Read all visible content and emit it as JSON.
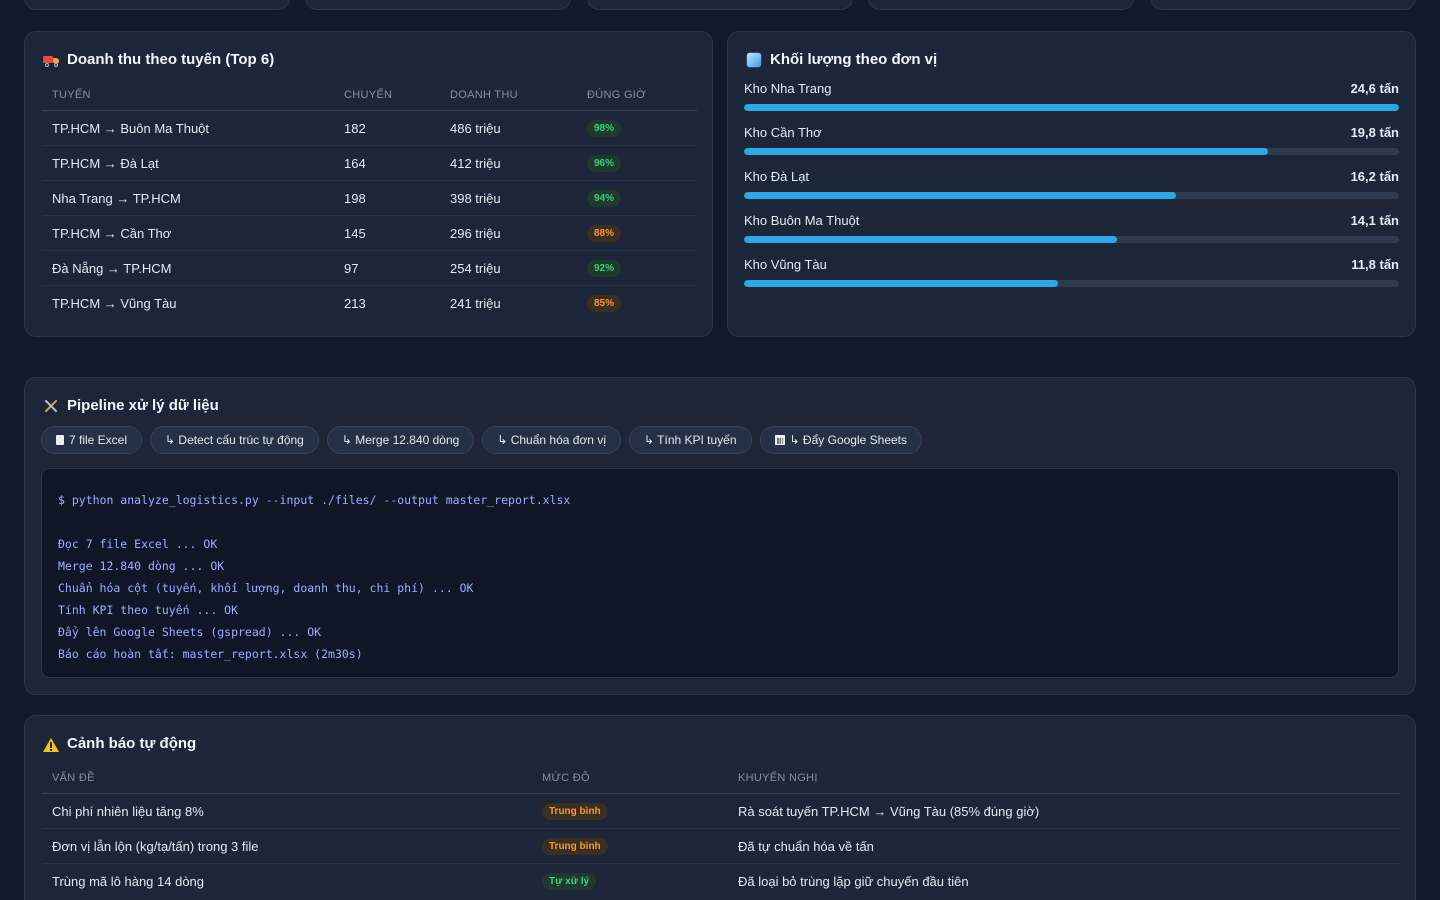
{
  "route_revenue": {
    "title": "Doanh thu theo tuyến (Top 6)",
    "columns": [
      "TUYẾN",
      "CHUYẾN",
      "DOANH THU",
      "ĐÚNG GIỜ"
    ],
    "rows": [
      {
        "route": "TP.HCM → Buôn Ma Thuột",
        "trips": "182",
        "revenue": "486 triệu",
        "ontime": "98%"
      },
      {
        "route": "TP.HCM → Đà Lạt",
        "trips": "164",
        "revenue": "412 triệu",
        "ontime": "96%"
      },
      {
        "route": "Nha Trang → TP.HCM",
        "trips": "198",
        "revenue": "398 triệu",
        "ontime": "94%"
      },
      {
        "route": "TP.HCM → Cần Thơ",
        "trips": "145",
        "revenue": "296 triệu",
        "ontime": "88%"
      },
      {
        "route": "Đà Nẵng → TP.HCM",
        "trips": "97",
        "revenue": "254 triệu",
        "ontime": "92%"
      },
      {
        "route": "TP.HCM → Vũng Tàu",
        "trips": "213",
        "revenue": "241 triệu",
        "ontime": "85%"
      }
    ]
  },
  "volume": {
    "title": "Khối lượng theo đơn vị",
    "items": [
      {
        "name": "Kho Nha Trang",
        "value": "24,6 tấn",
        "level": 1.0
      },
      {
        "name": "Kho Cần Thơ",
        "value": "19,8 tấn",
        "level": 0.8
      },
      {
        "name": "Kho Đà Lạt",
        "value": "16,2 tấn",
        "level": 0.66
      },
      {
        "name": "Kho Buôn Ma Thuột",
        "value": "14,1 tấn",
        "level": 0.57
      },
      {
        "name": "Kho Vũng Tàu",
        "value": "11,8 tấn",
        "level": 0.48
      }
    ]
  },
  "pipeline": {
    "title": "Pipeline xử lý dữ liệu",
    "steps": [
      "7 file Excel",
      "↳ Detect cấu trúc tự động",
      "↳ Merge 12.840 dòng",
      "↳ Chuẩn hóa đơn vị",
      "↳ Tính KPI tuyến",
      "↳ Đẩy Google Sheets"
    ],
    "terminal": {
      "command": "$ python analyze_logistics.py --input ./files/ --output master_report.xlsx",
      "lines": [
        "Đọc 7 file Excel ... OK",
        "Merge 12.840 dòng ... OK",
        "Chuẩn hóa cột (tuyến, khối lượng, doanh thu, chi phí) ... OK",
        "Tính KPI theo tuyến ... OK",
        "Đẩy lên Google Sheets (gspread) ... OK",
        "Báo cáo hoàn tất: master_report.xlsx (2m30s)"
      ]
    }
  },
  "alerts": {
    "title": "Cảnh báo tự động",
    "columns": [
      "VẤN ĐỀ",
      "MỨC ĐỘ",
      "KHUYẾN NGHỊ"
    ],
    "rows": [
      {
        "issue": "Chi phí nhiên liệu tăng 8%",
        "level": "Trung bình",
        "level_type": "orange",
        "advice": "Rà soát tuyến TP.HCM → Vũng Tàu (85% đúng giờ)"
      },
      {
        "issue": "Đơn vị lẫn lộn (kg/tạ/tấn) trong 3 file",
        "level": "Trung bình",
        "level_type": "orange",
        "advice": "Đã tự chuẩn hóa về tấn"
      },
      {
        "issue": "Trùng mã lô hàng 14 dòng",
        "level": "Tự xử lý",
        "level_type": "green",
        "advice": "Đã loại bỏ trùng lặp giữ chuyến đầu tiên"
      }
    ]
  },
  "colors": {
    "background": "#111a2c",
    "card": "#1c2638",
    "bar": "#2aa8e8",
    "good": "#34d17a",
    "warn": "#f59a2a"
  }
}
